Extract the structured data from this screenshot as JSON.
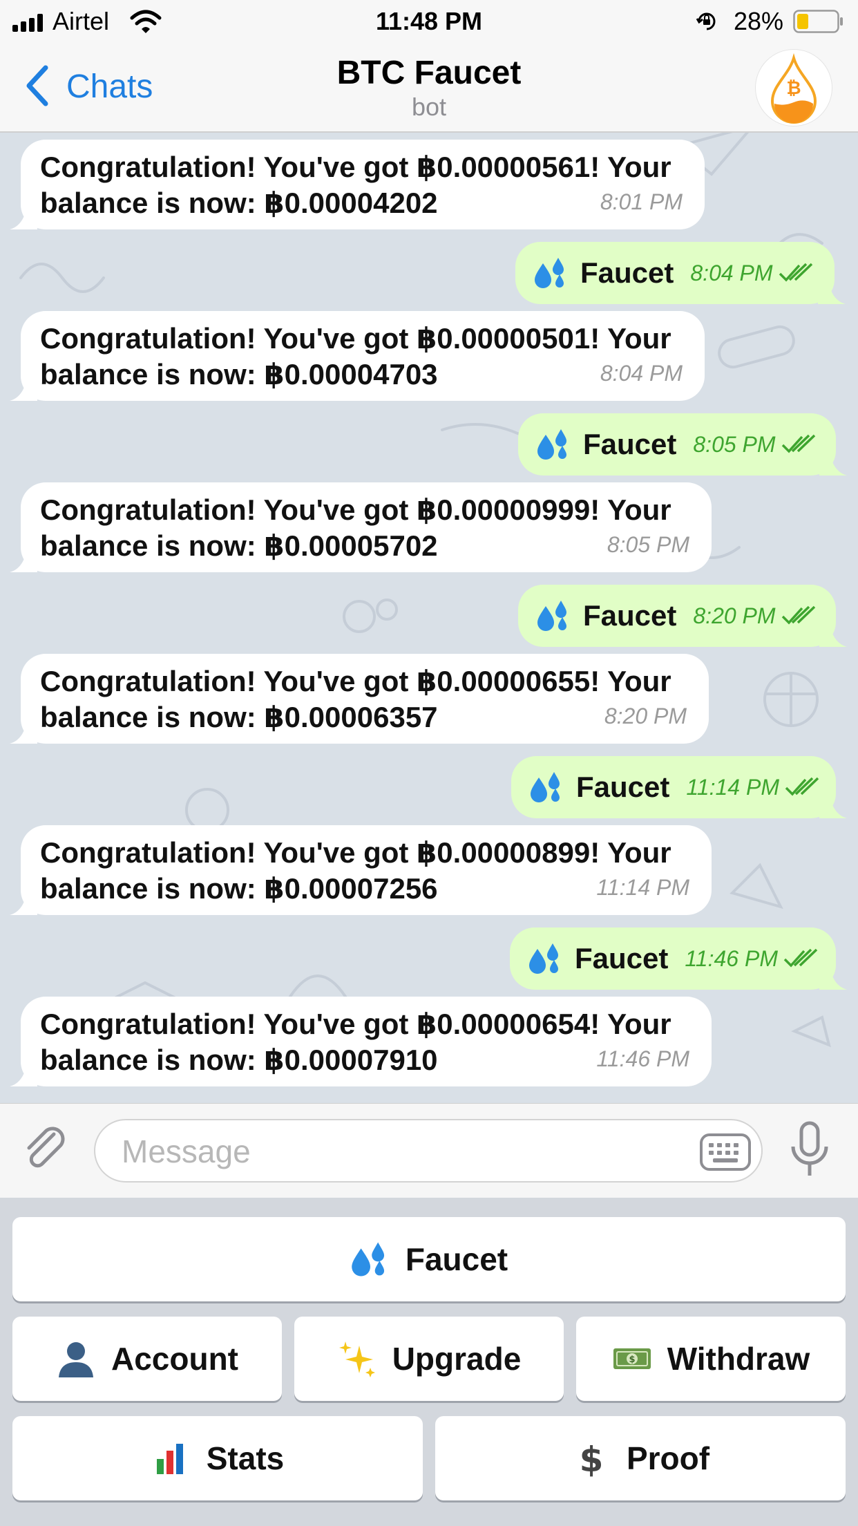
{
  "status_bar": {
    "carrier": "Airtel",
    "time": "11:48 PM",
    "battery": "28%"
  },
  "nav": {
    "back_label": "Chats",
    "title": "BTC Faucet",
    "subtitle": "bot"
  },
  "messages": [
    {
      "line1": "Congratulation! You've got ฿0.00000561! Your",
      "line2": "balance is now: ฿0.00004202",
      "time": "8:01 PM"
    },
    {
      "label": "Faucet",
      "time": "8:04 PM"
    },
    {
      "line1": "Congratulation! You've got ฿0.00000501! Your",
      "line2": "balance is now: ฿0.00004703",
      "time": "8:04 PM"
    },
    {
      "label": "Faucet",
      "time": "8:05 PM"
    },
    {
      "line1": "Congratulation! You've got ฿0.00000999! Your",
      "line2": "balance is now: ฿0.00005702",
      "time": "8:05 PM"
    },
    {
      "label": "Faucet",
      "time": "8:20 PM"
    },
    {
      "line1": "Congratulation! You've got ฿0.00000655! Your",
      "line2": "balance is now: ฿0.00006357",
      "time": "8:20 PM"
    },
    {
      "label": "Faucet",
      "time": "11:14 PM"
    },
    {
      "line1": "Congratulation! You've got ฿0.00000899! Your",
      "line2": "balance is now: ฿0.00007256",
      "time": "11:14 PM"
    },
    {
      "label": "Faucet",
      "time": "11:46 PM"
    },
    {
      "line1": "Congratulation! You've got ฿0.00000654! Your",
      "line2": "balance is now: ฿0.00007910",
      "time": "11:46 PM"
    }
  ],
  "input": {
    "placeholder": "Message"
  },
  "keyboard": {
    "faucet": "Faucet",
    "account": "Account",
    "upgrade": "Upgrade",
    "withdraw": "Withdraw",
    "stats": "Stats",
    "proof": "Proof"
  },
  "colors": {
    "accent": "#1f7fe0",
    "outgoing_bubble": "#e1fec6",
    "outgoing_time": "#3ea52f",
    "incoming_bubble": "#ffffff",
    "chat_background": "#d9e0e7"
  },
  "icons": {
    "avatar": "bitcoin-drop-logo",
    "faucet": "water-drops",
    "account": "bust-silhouette",
    "upgrade": "sparkles",
    "withdraw": "dollar-banknote",
    "stats": "bar-chart",
    "proof": "dollar-sign"
  }
}
